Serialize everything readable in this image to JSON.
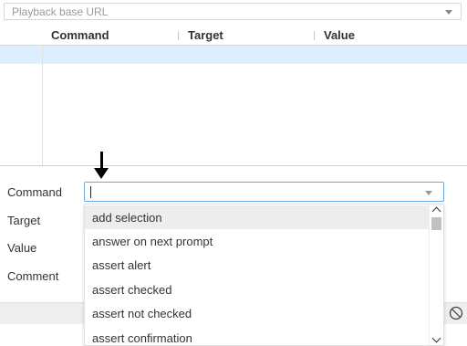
{
  "base_url": {
    "placeholder": "Playback base URL"
  },
  "columns": [
    "Command",
    "Target",
    "Value"
  ],
  "form": {
    "command_label": "Command",
    "target_label": "Target",
    "value_label": "Value",
    "comment_label": "Comment",
    "command_value": ""
  },
  "dropdown": {
    "options": [
      "add selection",
      "answer on next prompt",
      "assert alert",
      "assert checked",
      "assert not checked",
      "assert confirmation"
    ],
    "highlighted_index": 0
  },
  "icons": {
    "base_url_caret": "chevron-down-icon",
    "command_caret": "chevron-down-icon",
    "pointer_arrow": "arrow-down-icon",
    "disable_breakpoints": "ban-icon",
    "scroll_up": "chevron-up-icon",
    "scroll_down": "chevron-down-icon"
  },
  "colors": {
    "selected_row": "#ddeeff",
    "input_focus_border": "#6aa7e6",
    "option_highlight": "#ededed"
  }
}
